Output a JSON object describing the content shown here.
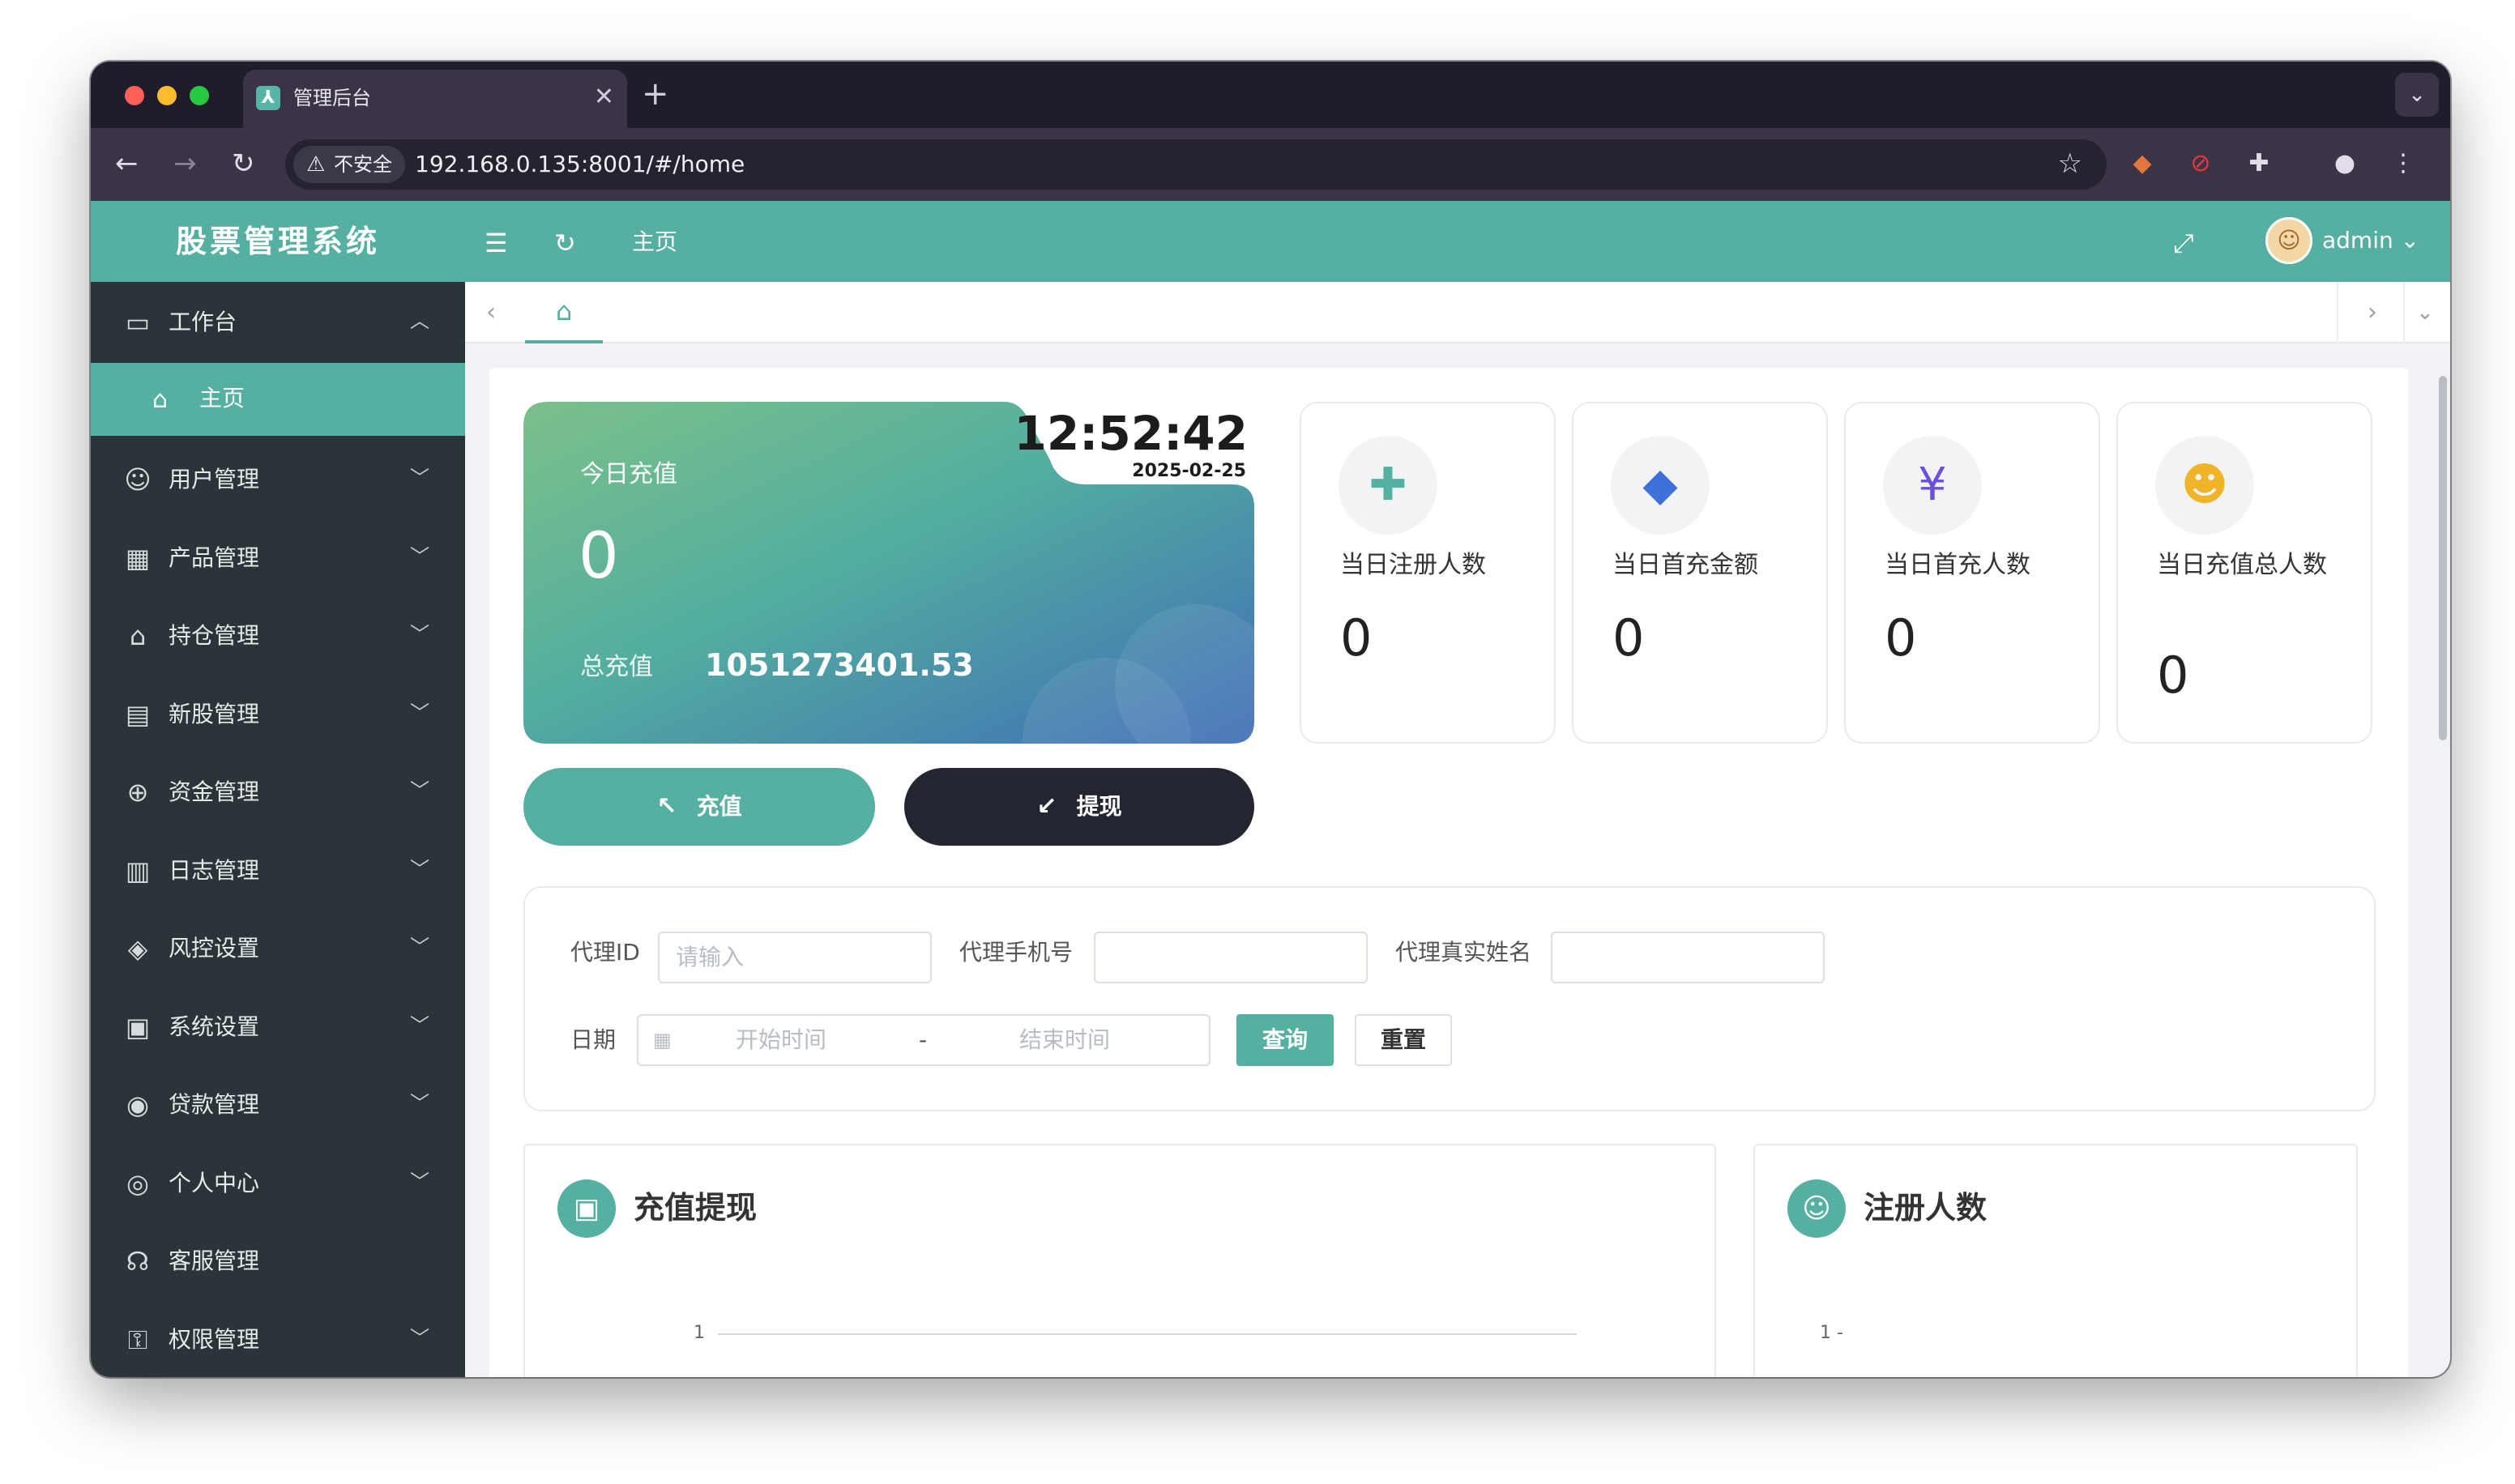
{
  "browser": {
    "tab_title": "管理后台",
    "tab_favicon": "⅄",
    "tab_close": "✕",
    "new_tab": "+",
    "tab_search_icon": "⌄",
    "insecure_label": "不安全",
    "url": "192.168.0.135:8001/#/home"
  },
  "header": {
    "brand": "股票管理系统",
    "crumb": "主页",
    "user": "admin"
  },
  "sidebar": {
    "workbench": "工作台",
    "home": "主页",
    "items": [
      {
        "label": "用户管理",
        "icon": "user-manage-icon",
        "glyph": "☺"
      },
      {
        "label": "产品管理",
        "icon": "grid-icon",
        "glyph": "▦"
      },
      {
        "label": "持仓管理",
        "icon": "house-icon",
        "glyph": "⌂"
      },
      {
        "label": "新股管理",
        "icon": "chart-icon",
        "glyph": "▤"
      },
      {
        "label": "资金管理",
        "icon": "money-icon",
        "glyph": "⊕"
      },
      {
        "label": "日志管理",
        "icon": "log-icon",
        "glyph": "▥"
      },
      {
        "label": "风控设置",
        "icon": "shield-icon",
        "glyph": "◈"
      },
      {
        "label": "系统设置",
        "icon": "monitor-gear-icon",
        "glyph": "▣"
      },
      {
        "label": "贷款管理",
        "icon": "loan-icon",
        "glyph": "◉"
      },
      {
        "label": "个人中心",
        "icon": "person-icon",
        "glyph": "◎"
      },
      {
        "label": "客服管理",
        "icon": "service-icon",
        "glyph": "☊"
      },
      {
        "label": "权限管理",
        "icon": "key-user-icon",
        "glyph": "⚿"
      }
    ]
  },
  "charge_card": {
    "clock": "12:52:42",
    "date": "2025-02-25",
    "label": "今日充值",
    "value": "0",
    "total_label": "总充值",
    "total_value": "1051273401.53"
  },
  "buttons": {
    "recharge": "充值",
    "withdraw": "提现"
  },
  "stats": [
    {
      "label": "当日注册人数",
      "value": "0",
      "icon": "user-add-icon",
      "color": "#56b0a2"
    },
    {
      "label": "当日首充金额",
      "value": "0",
      "icon": "money-bag-icon",
      "color": "#3f6fd8"
    },
    {
      "label": "当日首充人数",
      "value": "0",
      "icon": "user-yuan-icon",
      "color": "#6b4fd8"
    },
    {
      "label": "当日充值总人数",
      "value": "0",
      "icon": "users-icon",
      "color": "#f0b429"
    }
  ],
  "filter": {
    "agent_id_label": "代理ID",
    "agent_id_placeholder": "请输入",
    "agent_phone_label": "代理手机号",
    "agent_name_label": "代理真实姓名",
    "date_label": "日期",
    "start_placeholder": "开始时间",
    "separator": "-",
    "end_placeholder": "结束时间",
    "query": "查询",
    "reset": "重置"
  },
  "charts": {
    "left_title": "充值提现",
    "right_title": "注册人数",
    "left_tick": "1",
    "right_tick": "1 -"
  }
}
